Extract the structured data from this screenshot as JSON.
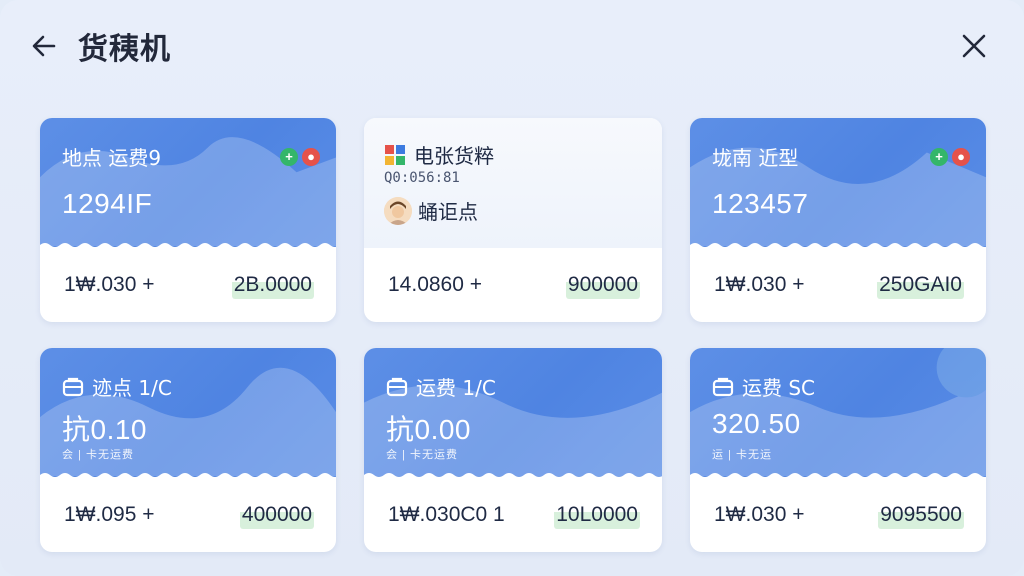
{
  "header": {
    "title": "货䄺机"
  },
  "cards": [
    {
      "label": "地点 运费9",
      "value": "1294IF",
      "left": "1₩.030 +",
      "right": "2B.0000",
      "badges": [
        "plus",
        "pin"
      ]
    },
    {
      "label": "电张货粹",
      "code": "Q0:056:81",
      "contact": "蛹讵点",
      "left": "14.0860 +",
      "right": "900000"
    },
    {
      "label": "垅南 近型",
      "value": "123457",
      "left": "1₩.030 +",
      "right": "250GAI0",
      "badges": [
        "plus",
        "pin"
      ]
    },
    {
      "label": "迹点 1/C",
      "value": "抗0.10",
      "sub": "会 | 卡无运费",
      "left": "1₩.095 +",
      "right": "400000"
    },
    {
      "label": "运费 1/C",
      "value": "抗0.00",
      "sub": "会 | 卡无运费",
      "left": "1₩.030C0 1",
      "right": "10L0000"
    },
    {
      "label": "运费 SC",
      "value": "320.50",
      "sub": "运 | 卡无运",
      "left": "1₩.030 +",
      "right": "9095500"
    }
  ],
  "colors": {
    "card_blue": "#5289e4",
    "accent_green": "#34b66a",
    "accent_red": "#e5524a",
    "amount_highlight": "#d8f0dc"
  },
  "icons": {
    "back": "arrow-left-icon",
    "close": "close-icon",
    "bag": "bag-icon",
    "logo": "app-logo-icon",
    "avatar": "avatar"
  }
}
